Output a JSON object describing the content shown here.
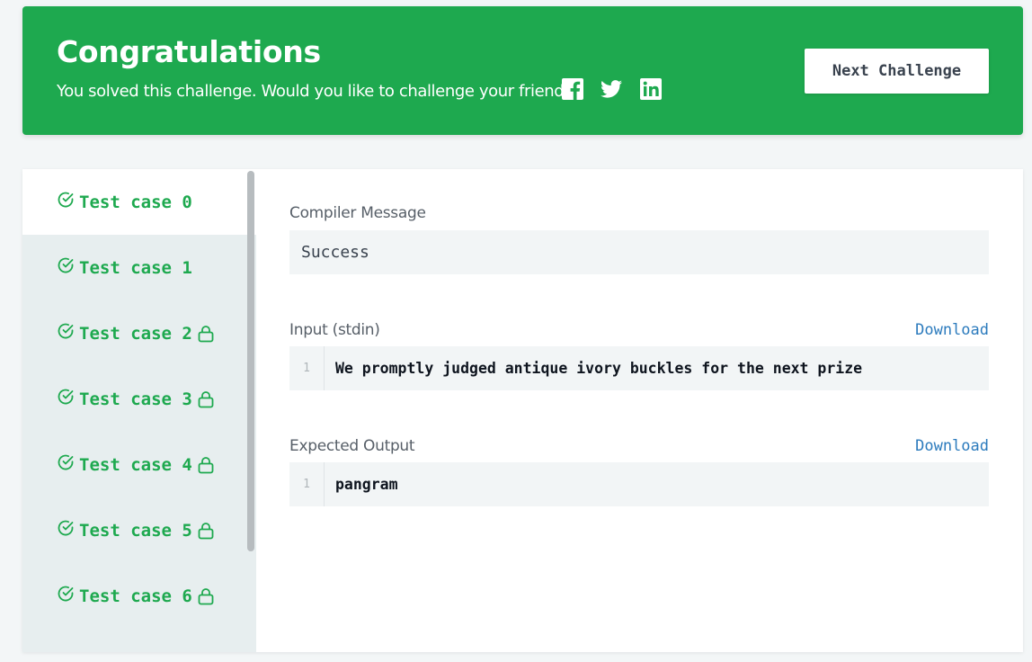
{
  "banner": {
    "title": "Congratulations",
    "subtitle": "You solved this challenge. Would you like to challenge your friends?",
    "social_icons": [
      "facebook-icon",
      "twitter-icon",
      "linkedin-icon"
    ],
    "next_button_label": "Next Challenge",
    "color": "#1ea94f"
  },
  "test_cases": [
    {
      "label": "Test case 0",
      "locked": false,
      "active": true
    },
    {
      "label": "Test case 1",
      "locked": false,
      "active": false
    },
    {
      "label": "Test case 2",
      "locked": true,
      "active": false
    },
    {
      "label": "Test case 3",
      "locked": true,
      "active": false
    },
    {
      "label": "Test case 4",
      "locked": true,
      "active": false
    },
    {
      "label": "Test case 5",
      "locked": true,
      "active": false
    },
    {
      "label": "Test case 6",
      "locked": true,
      "active": false
    }
  ],
  "result": {
    "compiler_label": "Compiler Message",
    "compiler_message": "Success",
    "input_label": "Input (stdin)",
    "input_download": "Download",
    "input_lines": [
      {
        "num": "1",
        "text": "We promptly judged antique ivory buckles for the next prize"
      }
    ],
    "expected_label": "Expected Output",
    "expected_download": "Download",
    "expected_lines": [
      {
        "num": "1",
        "text": "pangram"
      }
    ]
  }
}
